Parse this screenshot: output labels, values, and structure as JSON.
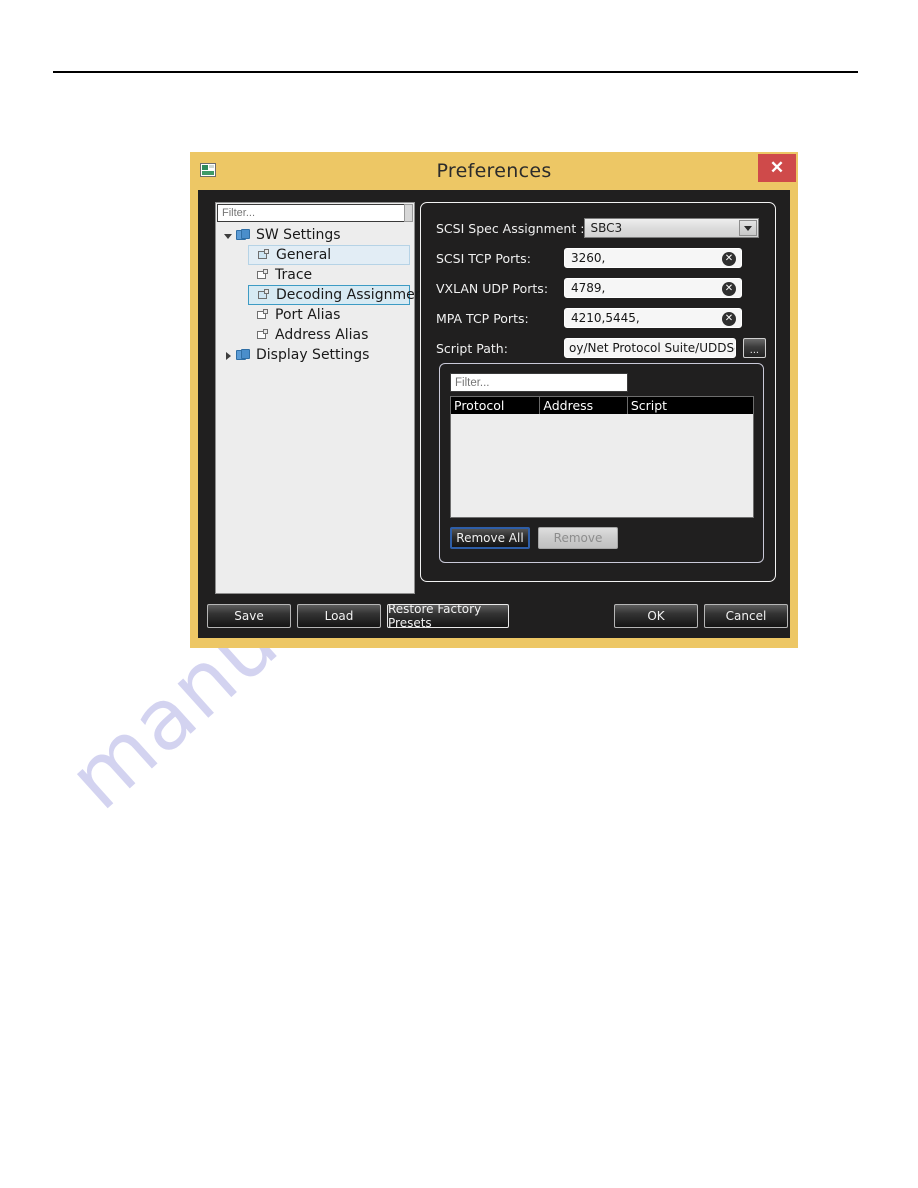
{
  "page": {
    "watermark": "manualshive.com",
    "rule": "horizontal-rule"
  },
  "dialog": {
    "title": "Preferences",
    "window_icon": "app-window-icon",
    "close_label": "✕"
  },
  "tree_panel": {
    "filter_placeholder": "Filter...",
    "filter_value": "",
    "items": [
      {
        "label": "SW Settings",
        "level": 0,
        "icon": "folder-icon",
        "expander": "open",
        "state": "normal"
      },
      {
        "label": "General",
        "level": 1,
        "icon": "page-icon",
        "expander": "none",
        "state": "hover"
      },
      {
        "label": "Trace",
        "level": 1,
        "icon": "page-icon",
        "expander": "none",
        "state": "normal"
      },
      {
        "label": "Decoding Assignment",
        "level": 1,
        "icon": "page-icon",
        "expander": "none",
        "state": "selected"
      },
      {
        "label": "Port Alias",
        "level": 1,
        "icon": "page-icon",
        "expander": "none",
        "state": "normal"
      },
      {
        "label": "Address Alias",
        "level": 1,
        "icon": "page-icon",
        "expander": "none",
        "state": "normal"
      },
      {
        "label": "Display Settings",
        "level": 0,
        "icon": "folder-icon",
        "expander": "closed",
        "state": "normal"
      }
    ]
  },
  "settings_form": {
    "scsi_spec": {
      "label": "SCSI Spec Assignment :",
      "value": "SBC3",
      "options": [
        "SBC3"
      ]
    },
    "scsi_tcp": {
      "label": "SCSI TCP Ports:",
      "value": "3260,",
      "clear_icon": "✕"
    },
    "vxlan_udp": {
      "label": "VXLAN UDP Ports:",
      "value": "4789,",
      "clear_icon": "✕"
    },
    "mpa_tcp": {
      "label": "MPA TCP Ports:",
      "value": "4210,5445,",
      "clear_icon": "✕"
    },
    "script_path": {
      "label": "Script Path:",
      "value": "oy/Net Protocol Suite/UDDScript\\",
      "browse_label": "..."
    }
  },
  "assignment_panel": {
    "filter_placeholder": "Filter...",
    "filter_value": "",
    "columns": [
      "Protocol",
      "Address",
      "Script"
    ],
    "rows": [],
    "remove_all_label": "Remove All",
    "remove_label": "Remove"
  },
  "footer": {
    "save_label": "Save",
    "load_label": "Load",
    "restore_label": "Restore Factory Presets",
    "ok_label": "OK",
    "cancel_label": "Cancel"
  },
  "colors": {
    "titlebar": "#edc765",
    "close_button": "#cf4a4a",
    "dialog_body": "#201f1f",
    "selection_border": "#3d9bc4",
    "focus_border": "#2e5ea8",
    "watermark": "#b9b9e8"
  }
}
